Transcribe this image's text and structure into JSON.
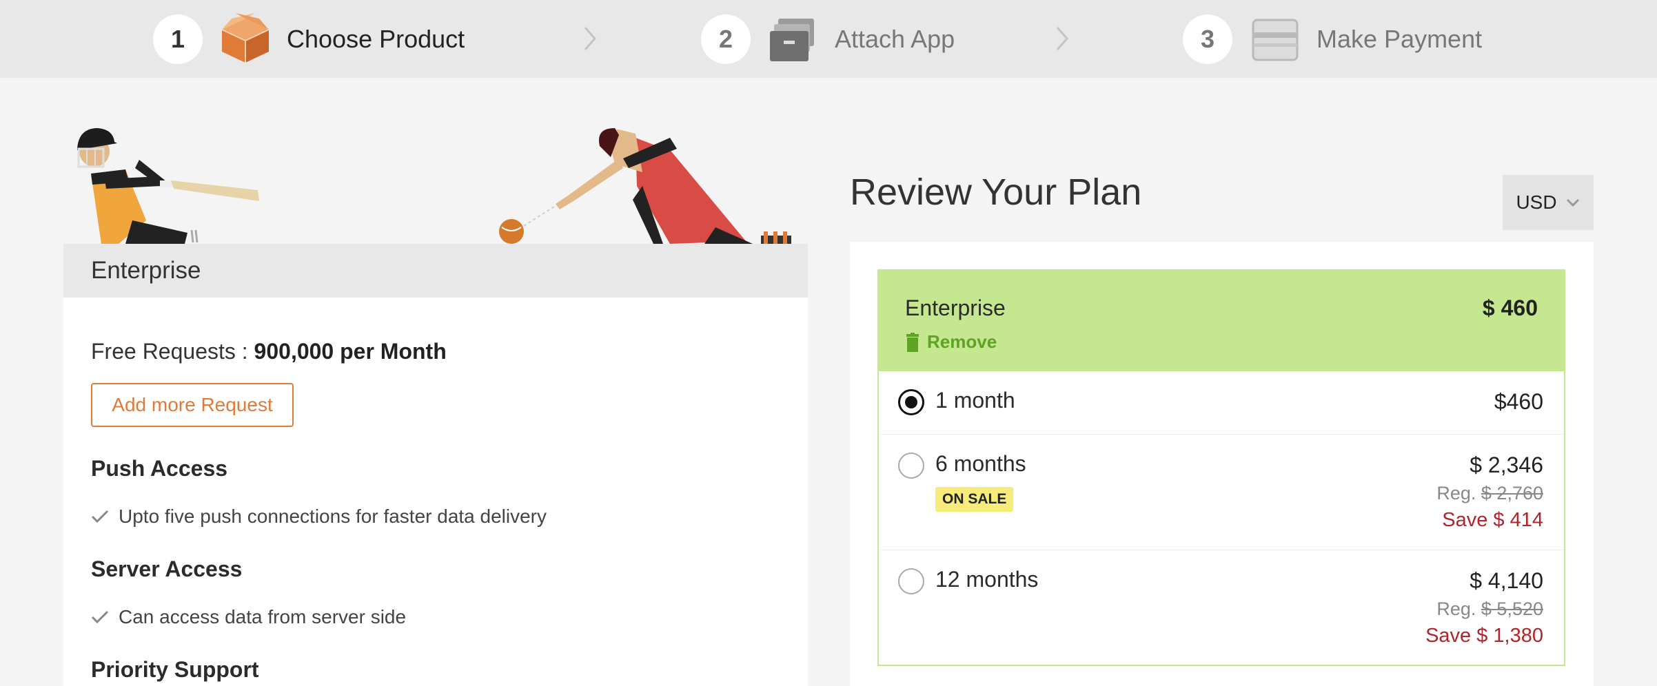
{
  "stepper": {
    "steps": [
      {
        "number": "1",
        "label": "Choose Product",
        "active": true,
        "icon": "box-icon"
      },
      {
        "number": "2",
        "label": "Attach App",
        "active": false,
        "icon": "stack-icon"
      },
      {
        "number": "3",
        "label": "Make Payment",
        "active": false,
        "icon": "card-icon"
      }
    ]
  },
  "product": {
    "name": "Enterprise",
    "free_requests_label": "Free Requests :",
    "free_requests_value": "900,000 per Month",
    "add_button": "Add more Request",
    "features": [
      {
        "title": "Push Access",
        "item": "Upto five push connections for faster data delivery"
      },
      {
        "title": "Server Access",
        "item": "Can access data from server side"
      },
      {
        "title": "Priority Support",
        "item": ""
      }
    ]
  },
  "review": {
    "title": "Review Your Plan",
    "currency": "USD",
    "plan_name": "Enterprise",
    "plan_price": "$ 460",
    "remove_label": "Remove",
    "options": [
      {
        "label": "1 month",
        "price": "$460",
        "selected": true
      },
      {
        "label": "6 months",
        "badge": "ON SALE",
        "price": "$ 2,346",
        "reg_label": "Reg.",
        "reg_price": "$ 2,760",
        "save": "Save $ 414",
        "selected": false
      },
      {
        "label": "12 months",
        "price": "$ 4,140",
        "reg_label": "Reg.",
        "reg_price": "$ 5,520",
        "save": "Save $ 1,380",
        "selected": false
      }
    ]
  },
  "colors": {
    "accent_orange": "#e07a38",
    "plan_green": "#c5e790",
    "remove_green": "#5fa324",
    "save_red": "#b0242a",
    "sale_yellow": "#f7eb7a"
  }
}
